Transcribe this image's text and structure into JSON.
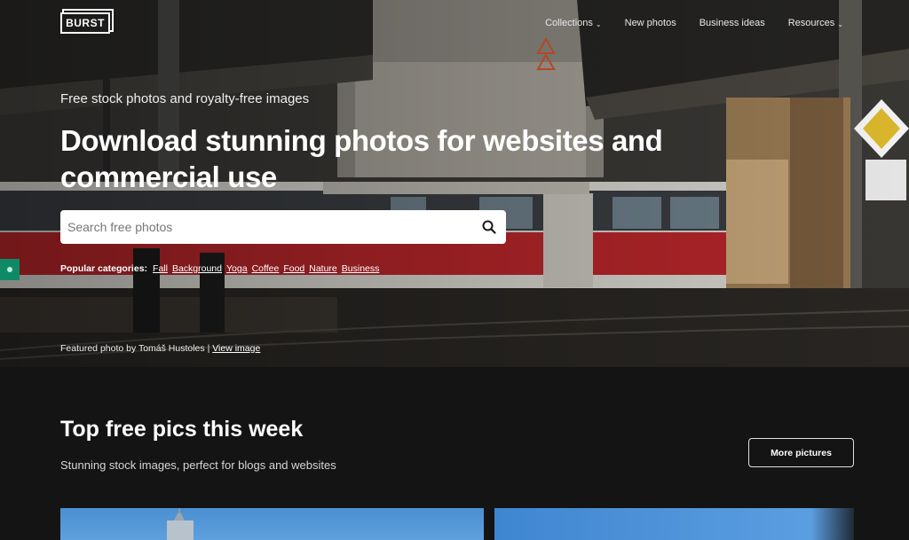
{
  "brand": {
    "logo_text": "BURST"
  },
  "nav": {
    "items": [
      {
        "label": "Collections",
        "has_dropdown": true
      },
      {
        "label": "New photos",
        "has_dropdown": false
      },
      {
        "label": "Business ideas",
        "has_dropdown": false
      },
      {
        "label": "Resources",
        "has_dropdown": true
      }
    ]
  },
  "hero": {
    "eyebrow": "Free stock photos and royalty-free images",
    "headline": "Download stunning photos for websites and commercial use",
    "search": {
      "placeholder": "Search free photos",
      "value": ""
    },
    "categories_label": "Popular categories:",
    "categories": [
      "Fall",
      "Background",
      "Yoga",
      "Coffee",
      "Food",
      "Nature",
      "Business"
    ],
    "credit_prefix": "Featured photo by Tomáš Hustoles |",
    "credit_link": "View image"
  },
  "section": {
    "title": "Top free pics this week",
    "subtitle": "Stunning stock images, perfect for blogs and websites",
    "more_button": "More pictures"
  },
  "colors": {
    "page_bg": "#141414",
    "side_tab": "#0f8a66",
    "tram_red": "#b8262a"
  },
  "icons": {
    "search": "search-icon",
    "chevron": "chevron-down-icon"
  }
}
